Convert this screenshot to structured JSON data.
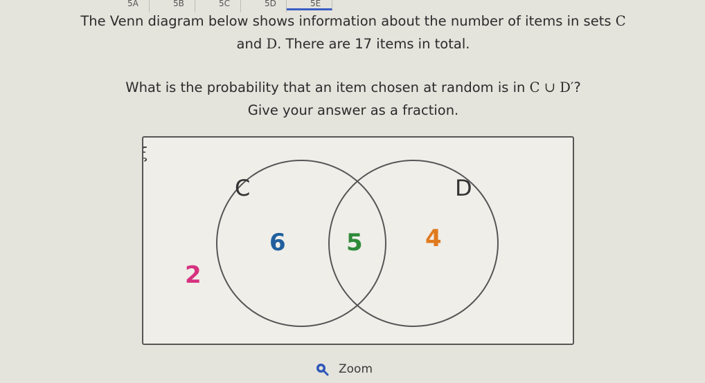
{
  "tabs": [
    {
      "label": "5A",
      "checked": true
    },
    {
      "label": "5B",
      "checked": true
    },
    {
      "label": "5C",
      "checked": true
    },
    {
      "label": "5D",
      "checked": false
    },
    {
      "label": "5E",
      "checked": false
    }
  ],
  "question": {
    "line1": "The Venn diagram below shows information about the number of items in sets",
    "set_c": "C",
    "line2a": "and",
    "set_d": "D",
    "line2b": ". There are 17 items in total.",
    "prompt": "What is the probability that an item chosen at random is in",
    "expression": "C ∪ D′",
    "qmark": "?",
    "instruction": "Give your answer as a fraction."
  },
  "venn": {
    "universal_symbol": "ξ",
    "label_c": "C",
    "label_d": "D",
    "only_c": "6",
    "both": "5",
    "only_d": "4",
    "outside": "2",
    "colors": {
      "only_c": "#1f5f9e",
      "both": "#2f8a3a",
      "only_d": "#e07a1e",
      "outside": "#d6327f"
    }
  },
  "zoom": {
    "label": "Zoom",
    "icon": "magnifier-icon"
  }
}
